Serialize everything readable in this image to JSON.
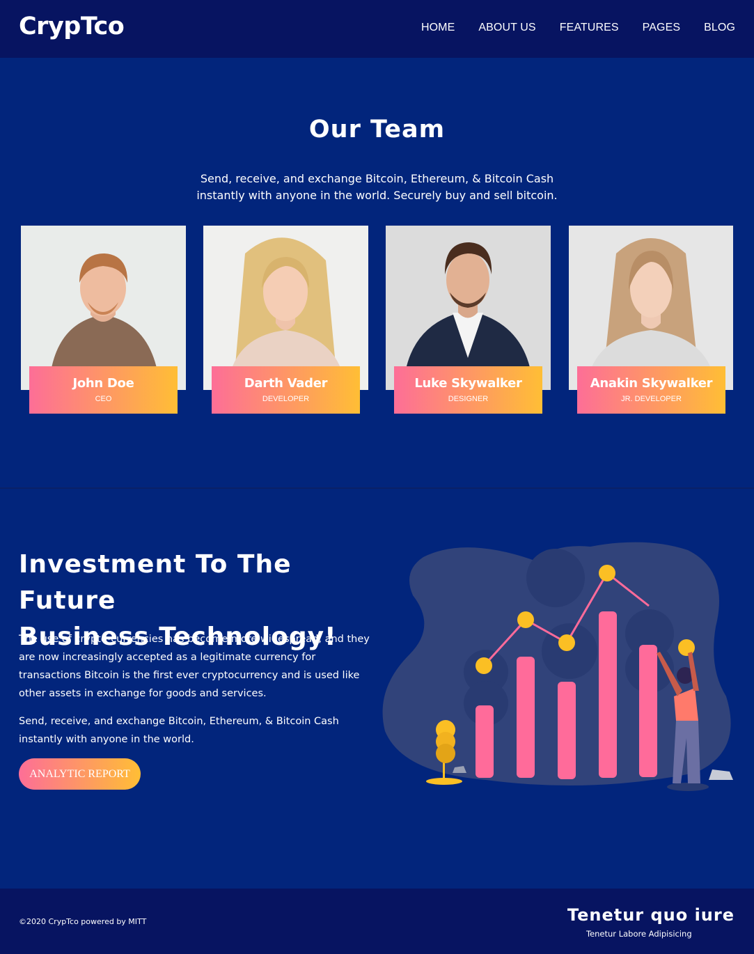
{
  "header": {
    "logo": "CrypTco",
    "nav": [
      "HOME",
      "ABOUT US",
      "FEATURES",
      "PAGES",
      "BLOG"
    ]
  },
  "team": {
    "title": "Our Team",
    "description_line1": "Send, receive, and exchange Bitcoin, Ethereum, & Bitcoin Cash",
    "description_line2": "instantly with anyone in the world. Securely buy and sell bitcoin.",
    "members": [
      {
        "name": "John Doe",
        "role": "CEO"
      },
      {
        "name": "Darth Vader",
        "role": "DEVELOPER"
      },
      {
        "name": "Luke Skywalker",
        "role": "DESIGNER"
      },
      {
        "name": "Anakin Skywalker",
        "role": "JR. DEVELOPER"
      }
    ]
  },
  "investment": {
    "title_line1": "Investment To The Future",
    "title_line2": "Business Technology!",
    "paragraph1": "The use of crypto-currencies has become more widespread, and they are now increasingly accepted as a legitimate currency for transactions Bitcoin is the first ever cryptocurrency and is used like other assets in exchange for goods and services.",
    "paragraph2": "Send, receive, and exchange Bitcoin, Ethereum, & Bitcoin Cash instantly with anyone in the world.",
    "button": "ANALYTIC REPORT"
  },
  "footer": {
    "copyright": "©2020 CrypTco powered by MITT",
    "title": "Tenetur quo iure",
    "subtitle": "Tenetur Labore Adipisicing"
  },
  "colors": {
    "nav_bg": "#071461",
    "page_bg": "#02257c",
    "gradient_start": "#fd6e97",
    "gradient_end": "#ffbe35"
  }
}
